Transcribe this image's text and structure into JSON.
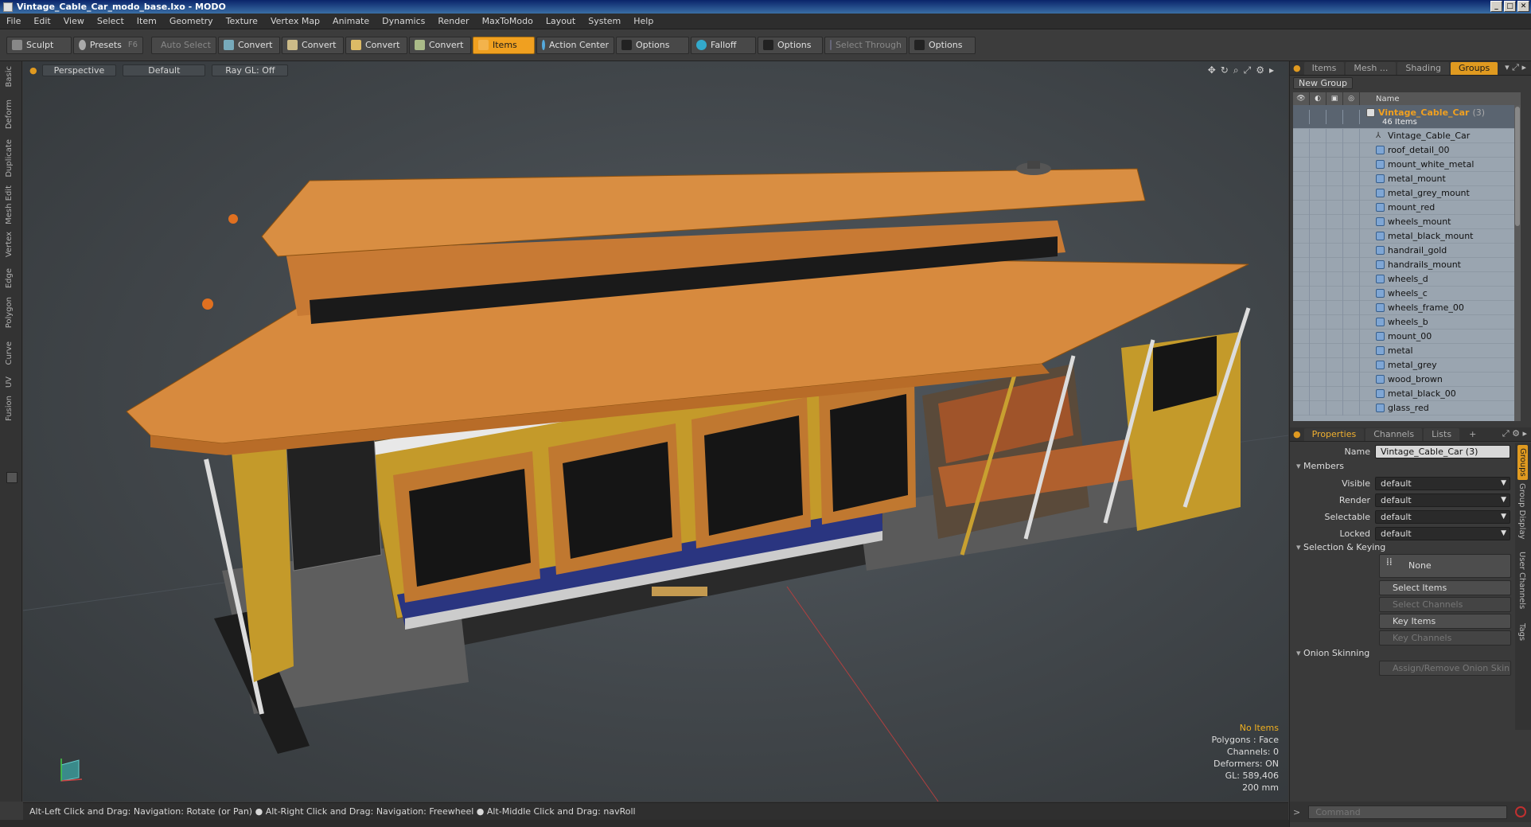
{
  "window": {
    "title": "Vintage_Cable_Car_modo_base.lxo - MODO",
    "buttons": [
      "_",
      "□",
      "✕"
    ]
  },
  "menubar": [
    "File",
    "Edit",
    "View",
    "Select",
    "Item",
    "Geometry",
    "Texture",
    "Vertex Map",
    "Animate",
    "Dynamics",
    "Render",
    "MaxToModo",
    "Layout",
    "System",
    "Help"
  ],
  "toolbar": {
    "sculpt": "Sculpt",
    "presets": "Presets",
    "presets_key": "F6",
    "auto_select": "Auto Select",
    "convert1": "Convert",
    "convert2": "Convert",
    "convert3": "Convert",
    "convert4": "Convert",
    "items": "Items",
    "action_center": "Action Center",
    "options1": "Options",
    "falloff": "Falloff",
    "options2": "Options",
    "select_through": "Select Through",
    "options3": "Options"
  },
  "left_tabs": [
    "Basic",
    "Deform",
    "Duplicate",
    "Mesh Edit",
    "Vertex",
    "Edge",
    "Polygon",
    "Curve",
    "UV",
    "Fusion"
  ],
  "viewport": {
    "view": "Perspective",
    "shading": "Default",
    "raygl": "Ray GL: Off",
    "info": {
      "no_items": "No Items",
      "polygons": "Polygons : Face",
      "channels": "Channels: 0",
      "deformers": "Deformers: ON",
      "gl": "GL: 589,406",
      "scale": "200 mm"
    }
  },
  "statusbar": "Alt-Left Click and Drag: Navigation: Rotate (or Pan) ● Alt-Right Click and Drag: Navigation: Freewheel ● Alt-Middle Click and Drag: navRoll",
  "right_panel": {
    "top_tabs": [
      "Items",
      "Mesh ...",
      "Shading",
      "Groups"
    ],
    "new_group": "New Group",
    "tree_header_name": "Name",
    "group": {
      "name": "Vintage_Cable_Car",
      "count_suffix": "(3)",
      "items_count": "46 Items"
    },
    "items": [
      "Vintage_Cable_Car",
      "roof_detail_00",
      "mount_white_metal",
      "metal_mount",
      "metal_grey_mount",
      "mount_red",
      "wheels_mount",
      "metal_black_mount",
      "handrail_gold",
      "handrails_mount",
      "wheels_d",
      "wheels_c",
      "wheels_frame_00",
      "wheels_b",
      "mount_00",
      "metal",
      "metal_grey",
      "wood_brown",
      "metal_black_00",
      "glass_red"
    ],
    "prop_tabs": [
      "Properties",
      "Channels",
      "Lists",
      "+"
    ],
    "properties": {
      "name_label": "Name",
      "name_value": "Vintage_Cable_Car (3)",
      "members": "Members",
      "visible_label": "Visible",
      "render_label": "Render",
      "selectable_label": "Selectable",
      "locked_label": "Locked",
      "default_value": "default",
      "selection_keying": "Selection & Keying",
      "none": "None",
      "select_items": "Select Items",
      "select_channels": "Select Channels",
      "key_items": "Key Items",
      "key_channels": "Key Channels",
      "onion_skinning": "Onion Skinning",
      "assign_onion": "Assign/Remove Onion Skin"
    },
    "side_tabs": [
      "Groups",
      "Group Display",
      "User Channels",
      "Tags"
    ],
    "command_placeholder": "Command"
  },
  "colors": {
    "accent": "#e09a20",
    "roof": "#d78a3e",
    "body": "#c8a030",
    "stripe": "#2a3580"
  }
}
